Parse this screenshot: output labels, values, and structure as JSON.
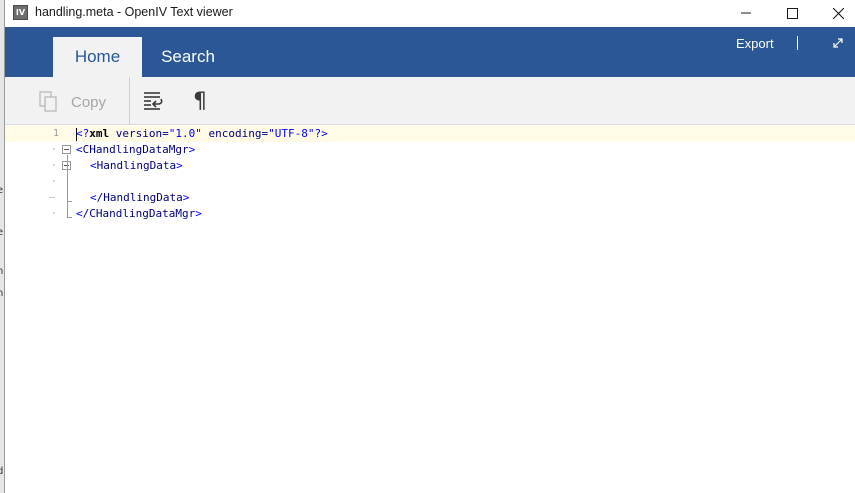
{
  "window": {
    "title": "handling.meta - OpenIV Text viewer",
    "app_icon_label": "IV"
  },
  "title_controls": {
    "minimize": "minimize-icon",
    "maximize": "maximize-icon",
    "close": "close-icon"
  },
  "ribbon": {
    "tabs": [
      {
        "label": "Home",
        "active": true
      },
      {
        "label": "Search",
        "active": false
      }
    ],
    "export_label": "Export"
  },
  "toolbar": {
    "copy_label": "Copy",
    "copy_enabled": false,
    "pilcrow": "¶"
  },
  "editor": {
    "lines": [
      {
        "number": "1",
        "text": "<?xml version=\"1.0\" encoding=\"UTF-8\"?>"
      },
      {
        "number": "",
        "text": "<CHandlingDataMgr>"
      },
      {
        "number": "",
        "text": "<HandlingData>"
      },
      {
        "number": "",
        "text": ""
      },
      {
        "number": "",
        "text": "</HandlingData>"
      },
      {
        "number": "",
        "text": "</CHandlingDataMgr>"
      }
    ],
    "line1_parts": {
      "open": "<?",
      "kw": "xml",
      "attr1": " version=",
      "val1": "\"1.0\"",
      "attr2": " encoding=",
      "val2": "\"UTF-8\"",
      "close": "?>"
    },
    "tags": {
      "mgr_open": "CHandlingDataMgr",
      "data_open": "HandlingData",
      "data_close": "/HandlingData",
      "mgr_close": "/CHandlingDataMgr"
    }
  },
  "colors": {
    "ribbon": "#2b5797",
    "active_tab_bg": "#f2f2f2",
    "current_line": "#fffbe6",
    "xml_bracket": "#0000ff",
    "xml_tag": "#000080"
  }
}
